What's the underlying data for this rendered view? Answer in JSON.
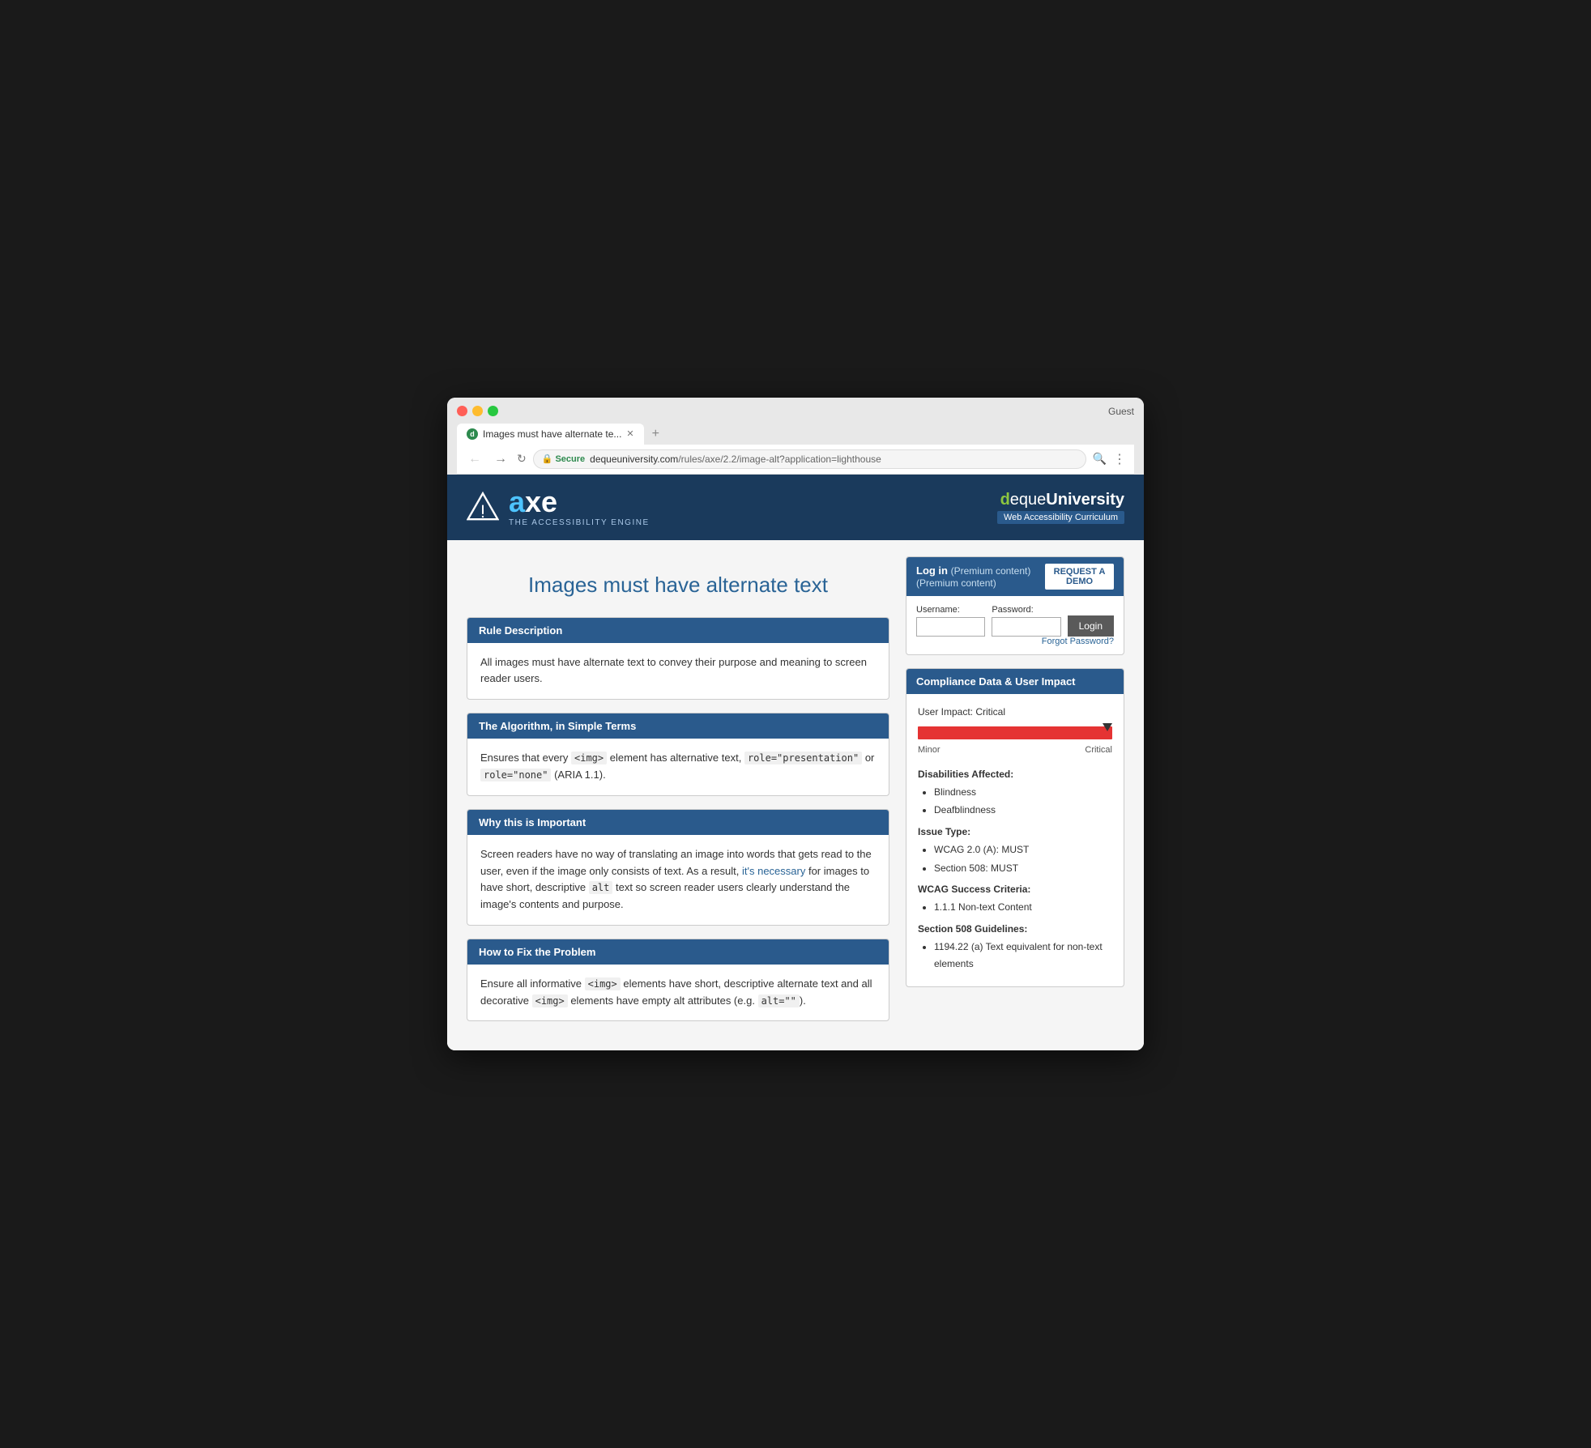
{
  "browser": {
    "guest_label": "Guest",
    "tab_title": "Images must have alternate te...",
    "tab_favicon": "d",
    "secure_label": "Secure",
    "url": "https://dequeuniversity.com/rules/axe/2.2/image-alt?application=lighthouse",
    "url_scheme": "https://",
    "url_domain": "dequeuniversity.com",
    "url_path": "/rules/axe/2.2/image-alt?application=lighthouse"
  },
  "header": {
    "logo_a": "a",
    "logo_xe": "xe",
    "logo_tagline": "THE ACCESSIBILITY ENGINE",
    "deque_d": "d",
    "deque_rest": "eque",
    "deque_bold": "University",
    "deque_subtitle": "Web Accessibility Curriculum"
  },
  "page": {
    "title": "Images must have alternate text"
  },
  "sections": [
    {
      "id": "rule_description",
      "header": "Rule Description",
      "body": "All images must have alternate text to convey their purpose and meaning to screen reader users."
    },
    {
      "id": "algorithm",
      "header": "The Algorithm, in Simple Terms",
      "body_html": "Ensures that every <img> element has alternative text, role=\"presentation\" or role=\"none\" (ARIA 1.1)."
    },
    {
      "id": "why_important",
      "header": "Why this is Important",
      "body": "Screen readers have no way of translating an image into words that gets read to the user, even if the image only consists of text. As a result, it's necessary for images to have short, descriptive alt text so screen reader users clearly understand the image's contents and purpose."
    },
    {
      "id": "how_to_fix",
      "header": "How to Fix the Problem",
      "body_html": "Ensure all informative <img> elements have short, descriptive alternate text and all decorative <img> elements have empty alt attributes (e.g. alt=\"\")."
    }
  ],
  "login": {
    "title": "Log in",
    "subtitle": "(Premium content)",
    "request_demo_label": "REQUEST A DEMO",
    "username_label": "Username:",
    "password_label": "Password:",
    "login_btn_label": "Login",
    "forgot_password_label": "Forgot Password?"
  },
  "compliance": {
    "header": "Compliance Data & User Impact",
    "user_impact_label": "User Impact: Critical",
    "impact_minor_label": "Minor",
    "impact_critical_label": "Critical",
    "disabilities_title": "Disabilities Affected:",
    "disabilities": [
      "Blindness",
      "Deafblindness"
    ],
    "issue_type_title": "Issue Type:",
    "issue_types": [
      "WCAG 2.0 (A): MUST",
      "Section 508: MUST"
    ],
    "wcag_title": "WCAG Success Criteria:",
    "wcag_criteria": [
      "1.1.1 Non-text Content"
    ],
    "section508_title": "Section 508 Guidelines:",
    "section508": [
      "1194.22 (a) Text equivalent for non-text elements"
    ]
  }
}
